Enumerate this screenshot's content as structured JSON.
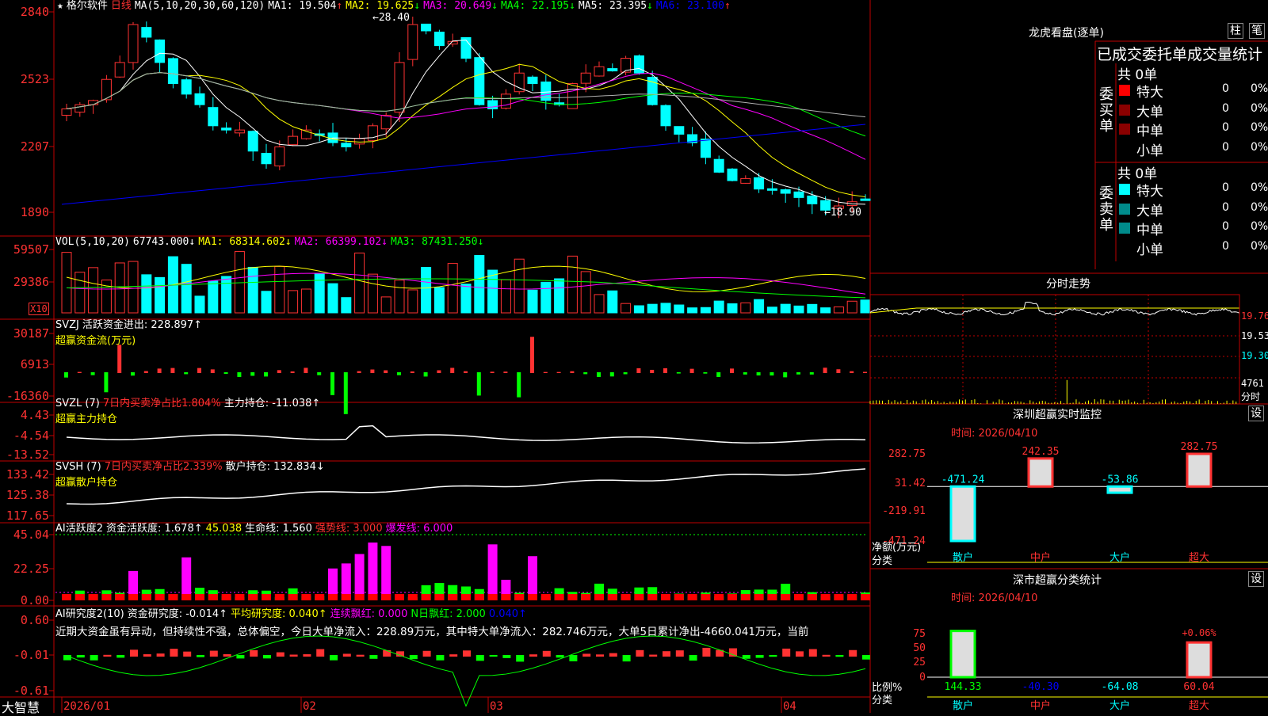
{
  "colors": {
    "up": "#ff3232",
    "down": "#00ffff",
    "ma1": "#ffffff",
    "ma2": "#ffff00",
    "ma3": "#ff00ff",
    "ma4": "#00ff00",
    "ma5": "#b0b0b0",
    "ma6": "#0000ff",
    "grid": "#c00000"
  },
  "header": {
    "star": "★",
    "stock_name": "格尔软件",
    "period": "日线",
    "ma_params": "MA(5,10,20,30,60,120)",
    "ma_values": [
      {
        "label": "MA1:",
        "value": "19.504",
        "arrow": "↑",
        "color": "#ffffff"
      },
      {
        "label": "MA2:",
        "value": "19.625",
        "arrow": "↓",
        "color": "#ffff00"
      },
      {
        "label": "MA3:",
        "value": "20.649",
        "arrow": "↓",
        "color": "#ff00ff"
      },
      {
        "label": "MA4:",
        "value": "22.195",
        "arrow": "↓",
        "color": "#00ff00"
      },
      {
        "label": "MA5:",
        "value": "23.395",
        "arrow": "↓",
        "color": "#ffffff"
      },
      {
        "label": "MA6:",
        "value": "23.100",
        "arrow": "↑",
        "color": "#0000ff"
      }
    ]
  },
  "price_axis": [
    "2840",
    "2523",
    "2207",
    "1890"
  ],
  "price_high_label": "28.40",
  "price_low_label": "18.90",
  "vol_panel": {
    "label": "VOL(5,10,20)",
    "value": "67743.000↓",
    "ma1": "MA1: 68314.602↓",
    "ma2": "MA2: 66399.102↓",
    "ma3": "MA3: 87431.250↓",
    "axis": [
      "59507",
      "29386"
    ],
    "unit": "X10"
  },
  "svzj_panel": {
    "label": "SVZJ",
    "desc": "活跃资金进出: 228.897↑",
    "sub": "超赢资金流(万元)",
    "axis": [
      "30187",
      "6913",
      "-16360"
    ]
  },
  "svzl_panel": {
    "label": "SVZL (7)",
    "desc1": "7日内买卖净占比1.804%",
    "desc2": "主力持仓: -11.038↑",
    "sub": "超赢主力持仓",
    "axis": [
      "4.43",
      "-4.54",
      "-13.52"
    ]
  },
  "svsh_panel": {
    "label": "SVSH (7)",
    "desc1": "7日内买卖净占比2.339%",
    "desc2": "散户持仓: 132.834↓",
    "sub": "超赢散户持仓",
    "axis": [
      "133.42",
      "125.38",
      "117.65"
    ]
  },
  "ai2_panel": {
    "label": "AI活跃度2",
    "desc": "资金活跃度: 1.678↑",
    "val2": "45.038",
    "desc3": "生命线: 1.560",
    "strong": "强势线: 3.000",
    "burst": "爆发线: 6.000",
    "axis": [
      "45.04",
      "22.25",
      "0.00"
    ]
  },
  "ai_research": {
    "label": "AI研究度2(10)",
    "desc": "资金研究度: -0.014↑",
    "avg": "平均研究度: 0.040↑",
    "cont": "连续飘红: 0.000",
    "nday": "N日飘红: 2.000",
    "last": "0.040↑",
    "comment": "近期大资金虽有异动，但持续性不强，总体偏空，今日大单净流入：228.89万元，其中特大单净流入：282.746万元，大单5日累计净出-4660.041万元，当前",
    "axis": [
      "0.60",
      "-0.01",
      "-0.61"
    ]
  },
  "footer": {
    "logo": "大智慧",
    "dates": [
      "2026/01",
      "02",
      "03",
      "04"
    ]
  },
  "right_top": {
    "title": "龙虎看盘(逐单)",
    "btn_col": "柱",
    "btn_pen": "笔",
    "subtitle": "已成交委托单成交量统计",
    "buy": {
      "side": "委买单",
      "total": "共 0单",
      "rows": [
        {
          "name": "特大",
          "val": "0",
          "pct": "0%",
          "color": "#ff0000"
        },
        {
          "name": "大单",
          "val": "0",
          "pct": "0%",
          "color": "#8b0000"
        },
        {
          "name": "中单",
          "val": "0",
          "pct": "0%",
          "color": "#8b0000"
        },
        {
          "name": "小单",
          "val": "0",
          "pct": "0%",
          "color": ""
        }
      ]
    },
    "sell": {
      "side": "委卖单",
      "total": "共 0单",
      "rows": [
        {
          "name": "特大",
          "val": "0",
          "pct": "0%",
          "color": "#00ffff"
        },
        {
          "name": "大单",
          "val": "0",
          "pct": "0%",
          "color": "#008b8b"
        },
        {
          "name": "中单",
          "val": "0",
          "pct": "0%",
          "color": "#008b8b"
        },
        {
          "name": "小单",
          "val": "0",
          "pct": "0%",
          "color": ""
        }
      ]
    }
  },
  "intraday": {
    "title": "分时走势",
    "axis": [
      "19.76",
      "19.53",
      "19.30"
    ],
    "vol_label": "4761",
    "vol_unit": "分时"
  },
  "sz_monitor": {
    "title": "深圳超赢实时监控",
    "btn": "设",
    "time": "时间: 2026/04/10",
    "axis": [
      "282.75",
      "31.42",
      "-219.91",
      "-471.24"
    ],
    "ylabel": "净额(万元)",
    "xlabel": "分类",
    "bars": [
      {
        "cat": "散户",
        "value": -471.24,
        "label": "-471.24"
      },
      {
        "cat": "中户",
        "value": 242.35,
        "label": "242.35"
      },
      {
        "cat": "大户",
        "value": -53.86,
        "label": "-53.86"
      },
      {
        "cat": "超大",
        "value": 282.75,
        "label": "282.75"
      }
    ]
  },
  "sz_class": {
    "title": "深市超赢分类统计",
    "btn": "设",
    "time": "时间: 2026/04/10",
    "axis": [
      "75",
      "50",
      "25",
      "0"
    ],
    "ylabel": "比例%",
    "xlabel": "分类",
    "bars": [
      {
        "cat": "散户",
        "value": 144.33,
        "label": "144.33"
      },
      {
        "cat": "中户",
        "value": -40.3,
        "label": "-40.30"
      },
      {
        "cat": "大户",
        "value": -64.08,
        "label": "-64.08"
      },
      {
        "cat": "超大",
        "value": 60.04,
        "label": "60.04"
      }
    ],
    "note": "+0.06%"
  }
}
